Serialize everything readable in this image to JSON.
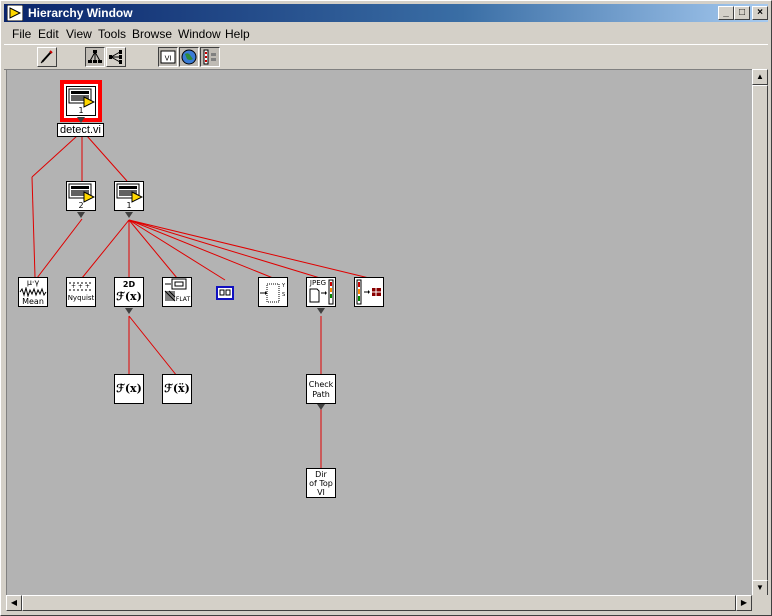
{
  "window": {
    "title": "Hierarchy Window",
    "min_glyph": "_",
    "max_glyph": "□",
    "close_glyph": "×"
  },
  "menu": [
    {
      "label": "File"
    },
    {
      "label": "Edit"
    },
    {
      "label": "View"
    },
    {
      "label": "Tools"
    },
    {
      "label": "Browse"
    },
    {
      "label": "Window"
    },
    {
      "label": "Help"
    }
  ],
  "toolbar": {
    "edit_tool": "pencil-icon",
    "layout_vertical": "vertical-layout-icon",
    "layout_horizontal": "horizontal-layout-icon",
    "include_vi_lib": "vi-lib-icon",
    "include_globals": "globe-icon",
    "include_typedefs": "typedef-icon"
  },
  "nodes": {
    "root": {
      "label": "detect.vi",
      "count": "1"
    },
    "sub_a": {
      "count": "2"
    },
    "sub_b": {
      "count": "1"
    },
    "mean": {
      "line1": "μ·γ",
      "line2": "Mean"
    },
    "nyquist": {
      "label": "Nyquist"
    },
    "fft2d": {
      "line1": "2D",
      "line2": "ℱ(x)"
    },
    "flatten": {
      "label": "FLAT"
    },
    "jpeg": {
      "label": "JPEG"
    },
    "fx": {
      "label": "ℱ(x)"
    },
    "fx_inv": {
      "label": "ℱ(ẍ)"
    },
    "check_path": {
      "line1": "Check",
      "line2": "Path"
    },
    "dir_top": {
      "line1": "Dir",
      "line2": "of Top",
      "line3": "VI"
    }
  },
  "colors": {
    "canvas": "#b3b3b3",
    "link": "#e00000",
    "highlight": "#ff0000",
    "title_start": "#0a246a",
    "title_end": "#a6caf0"
  }
}
